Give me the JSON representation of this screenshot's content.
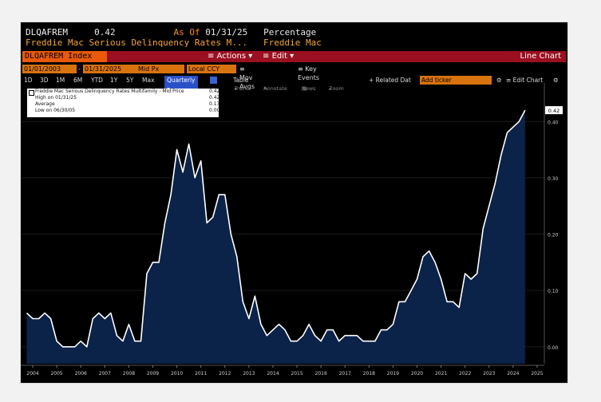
{
  "header": {
    "ticker": "DLQAFREM",
    "value": "0.42",
    "as_of_label": "As Of",
    "as_of_date": "01/31/25",
    "units": "Percentage",
    "description": "Freddie Mac Serious Delinquency Rates M...",
    "source": "Freddie Mac"
  },
  "toolbar": {
    "index_label": "DLQAFREM Index",
    "actions_label": "≡ Actions ▾",
    "edit_label": "≡ Edit ▾",
    "chart_type": "Line Chart",
    "start_date": "01/01/2003",
    "end_date": "01/31/2025",
    "price_type": "Mid Px",
    "currency": "Local CCY",
    "mov_avgs": "≡ Mov Avgs",
    "key_events": "≡ Key Events",
    "periods": [
      "1D",
      "3D",
      "1M",
      "6M",
      "YTD",
      "1Y",
      "5Y",
      "Max"
    ],
    "frequency": "Quarterly ▾",
    "table_label": "Table",
    "related_data": "+ Related Dat",
    "search_value": "Add ticker",
    "edit_chart": "≡ Edit Chart",
    "track": "Track",
    "annotate": "Annotate",
    "news": "News",
    "zoom": "Zoom"
  },
  "legend": {
    "series_name": "Freddie Mac Serious Delinquency Rates Multifamily - Mid Price",
    "series_value": "0.42",
    "high_label": "High on 01/31/25",
    "high_value": "0.42",
    "average_label": "Average",
    "average_value": "0.13",
    "low_label": "Low on 06/30/05",
    "low_value": "0.00"
  },
  "colors": {
    "background": "#000000",
    "line": "#ffffff",
    "area_fill": "#0b2249",
    "accent_orange": "#e8590c",
    "accent_red": "#9a1020"
  },
  "chart_data": {
    "type": "area",
    "title": "Freddie Mac Serious Delinquency Rates Multifamily",
    "ylabel": "Percentage",
    "ylim": [
      -0.03,
      0.44
    ],
    "yticks": [
      "0.00",
      "0.10",
      "0.20",
      "0.30",
      "0.40"
    ],
    "ytick_values": [
      0,
      0.1,
      0.2,
      0.3,
      0.4
    ],
    "xticks": [
      "2004",
      "2005",
      "2006",
      "2007",
      "2008",
      "2009",
      "2010",
      "2011",
      "2012",
      "2013",
      "2014",
      "2015",
      "2016",
      "2017",
      "2018",
      "2019",
      "2020",
      "2021",
      "2022",
      "2023",
      "2024",
      "2025"
    ],
    "last_value_label": "0.42",
    "series": [
      {
        "name": "Freddie Mac Serious Delinquency Rates Multifamily - Mid Price",
        "x_start": 2003.75,
        "x_step": 0.25,
        "values": [
          0.06,
          0.05,
          0.05,
          0.06,
          0.05,
          0.01,
          0.0,
          0.0,
          0.0,
          0.01,
          0.0,
          0.05,
          0.06,
          0.05,
          0.06,
          0.02,
          0.01,
          0.04,
          0.01,
          0.01,
          0.13,
          0.15,
          0.15,
          0.22,
          0.27,
          0.35,
          0.31,
          0.36,
          0.3,
          0.33,
          0.22,
          0.23,
          0.27,
          0.27,
          0.2,
          0.16,
          0.08,
          0.05,
          0.09,
          0.04,
          0.02,
          0.03,
          0.04,
          0.03,
          0.01,
          0.01,
          0.02,
          0.04,
          0.02,
          0.01,
          0.03,
          0.03,
          0.01,
          0.02,
          0.02,
          0.02,
          0.01,
          0.01,
          0.01,
          0.03,
          0.03,
          0.04,
          0.08,
          0.08,
          0.1,
          0.12,
          0.16,
          0.17,
          0.15,
          0.12,
          0.08,
          0.08,
          0.07,
          0.13,
          0.12,
          0.13,
          0.21,
          0.25,
          0.29,
          0.34,
          0.38,
          0.39,
          0.4,
          0.42
        ]
      }
    ]
  }
}
